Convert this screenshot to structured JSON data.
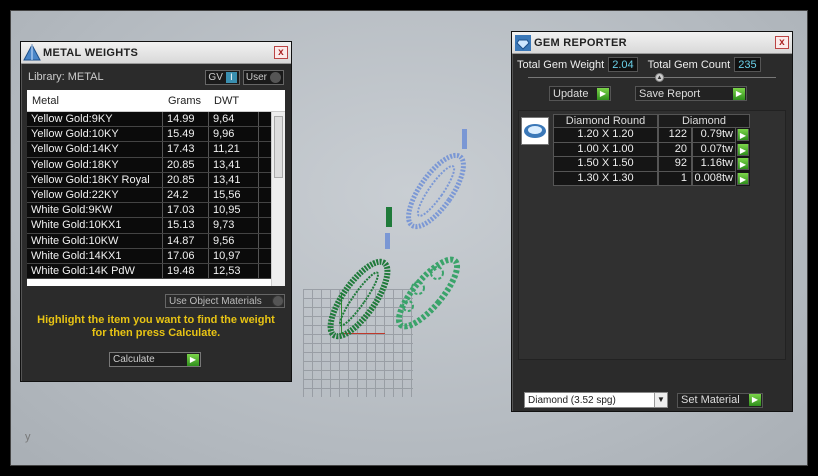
{
  "metal_weights": {
    "title": "METAL WEIGHTS",
    "library_label": "Library: METAL",
    "toggle_gv": "GV",
    "toggle_user": "User",
    "columns": [
      "Metal",
      "Grams",
      "DWT"
    ],
    "rows": [
      [
        "Yellow Gold:9KY",
        "14.99",
        "9,64"
      ],
      [
        "Yellow Gold:10KY",
        "15.49",
        "9,96"
      ],
      [
        "Yellow Gold:14KY",
        "17.43",
        "11,21"
      ],
      [
        "Yellow Gold:18KY",
        "20.85",
        "13,41"
      ],
      [
        "Yellow Gold:18KY Royal",
        "20.85",
        "13,41"
      ],
      [
        "Yellow Gold:22KY",
        "24.2",
        "15,56"
      ],
      [
        "White Gold:9KW",
        "17.03",
        "10,95"
      ],
      [
        "White Gold:10KX1",
        "15.13",
        "9,73"
      ],
      [
        "White Gold:10KW",
        "14.87",
        "9,56"
      ],
      [
        "White Gold:14KX1",
        "17.06",
        "10,97"
      ],
      [
        "White Gold:14K PdW",
        "19.48",
        "12,53"
      ]
    ],
    "use_object_materials": "Use Object Materials",
    "hint": "Highlight the item you want to find the weight for then press Calculate.",
    "calculate_label": "Calculate",
    "close": "x"
  },
  "gem_reporter": {
    "title": "GEM REPORTER",
    "total_weight_label": "Total Gem Weight",
    "total_weight_value": "2.04",
    "total_count_label": "Total Gem Count",
    "total_count_value": "235",
    "update_label": "Update",
    "save_report_label": "Save Report",
    "table_headers": [
      "Diamond Round",
      "Diamond"
    ],
    "rows": [
      [
        "1.20 X 1.20",
        "122",
        "0.79tw"
      ],
      [
        "1.00 X 1.00",
        "20",
        "0.07tw"
      ],
      [
        "1.50 X 1.50",
        "92",
        "1.16tw"
      ],
      [
        "1.30 X 1.30",
        "1",
        "0.008tw"
      ]
    ],
    "material_value": "Diamond      (3.52 spg)",
    "set_material_label": "Set Material",
    "close": "x"
  }
}
